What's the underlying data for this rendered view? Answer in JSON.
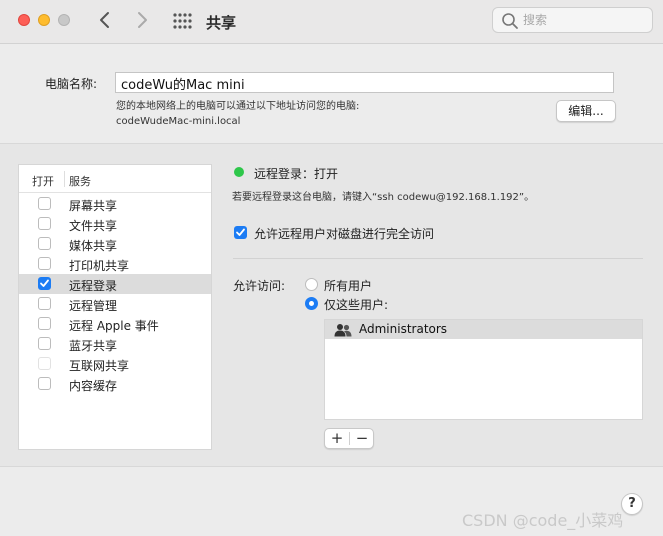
{
  "toolbar": {
    "title": "共享",
    "search_placeholder": "搜索"
  },
  "computer": {
    "name_label": "电脑名称:",
    "name_value": "codeWu的Mac mini",
    "desc_line1": "您的本地网络上的电脑可以通过以下地址访问您的电脑:",
    "desc_line2": "codeWudeMac-mini.local",
    "edit_button": "编辑..."
  },
  "services": {
    "header_open": "打开",
    "header_service": "服务",
    "items": [
      {
        "label": "屏幕共享",
        "checked": false,
        "disabled": false
      },
      {
        "label": "文件共享",
        "checked": false,
        "disabled": false
      },
      {
        "label": "媒体共享",
        "checked": false,
        "disabled": false
      },
      {
        "label": "打印机共享",
        "checked": false,
        "disabled": false
      },
      {
        "label": "远程登录",
        "checked": true,
        "disabled": false,
        "selected": true
      },
      {
        "label": "远程管理",
        "checked": false,
        "disabled": false
      },
      {
        "label": "远程 Apple 事件",
        "checked": false,
        "disabled": false
      },
      {
        "label": "蓝牙共享",
        "checked": false,
        "disabled": false
      },
      {
        "label": "互联网共享",
        "checked": false,
        "disabled": true
      },
      {
        "label": "内容缓存",
        "checked": false,
        "disabled": false
      }
    ]
  },
  "detail": {
    "status": "远程登录：打开",
    "status_color": "#2ec74a",
    "hint": "若要远程登录这台电脑，请键入“ssh codewu@192.168.1.192”。",
    "full_disk_label": "允许远程用户对磁盘进行完全访问",
    "access_label": "允许访问:",
    "radio_all": "所有用户",
    "radio_some": "仅这些用户:",
    "users": [
      "Administrators"
    ],
    "add_label": "+",
    "remove_label": "−"
  },
  "help_label": "?",
  "watermark": "CSDN @code_小菜鸡",
  "accent_color": "#1c7cf4"
}
